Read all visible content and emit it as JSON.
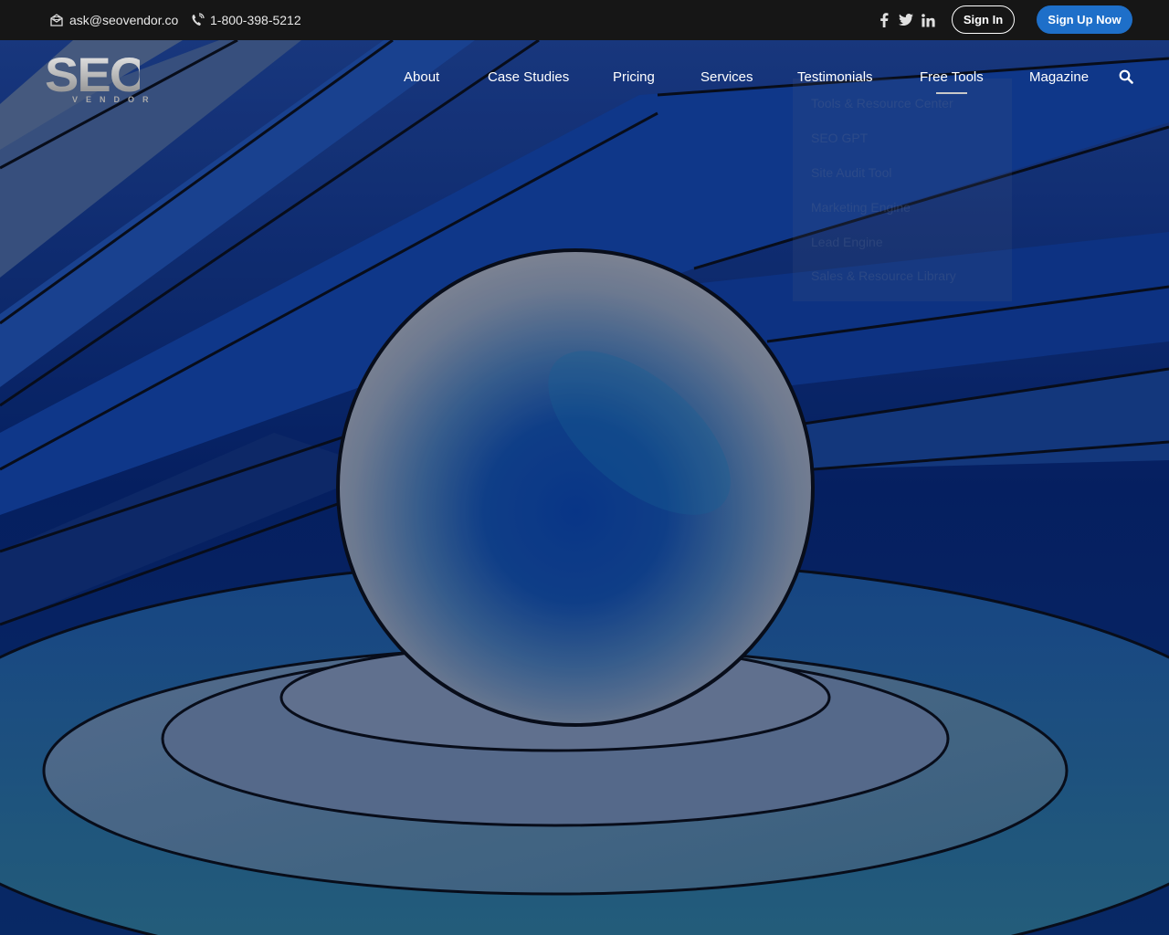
{
  "topbar": {
    "email": "ask@seovendor.co",
    "phone": "1-800-398-5212",
    "social": [
      "facebook-icon",
      "twitter-icon",
      "linkedin-icon"
    ],
    "sign_in_label": "Sign In",
    "sign_up_label": "Sign Up Now",
    "sign_up_color": "#1e6fc9"
  },
  "logo": {
    "big_text": "SEO",
    "small_text": "VENDOR"
  },
  "nav": {
    "items": [
      "About",
      "Case Studies",
      "Pricing",
      "Services",
      "Testimonials",
      "Free Tools",
      "Magazine"
    ],
    "active": "Free Tools"
  },
  "dropdown": {
    "items": [
      "Tools & Resource Center",
      "SEO GPT",
      "Site Audit Tool",
      "Marketing Engine",
      "Lead Engine",
      "Sales & Resource Library"
    ]
  }
}
